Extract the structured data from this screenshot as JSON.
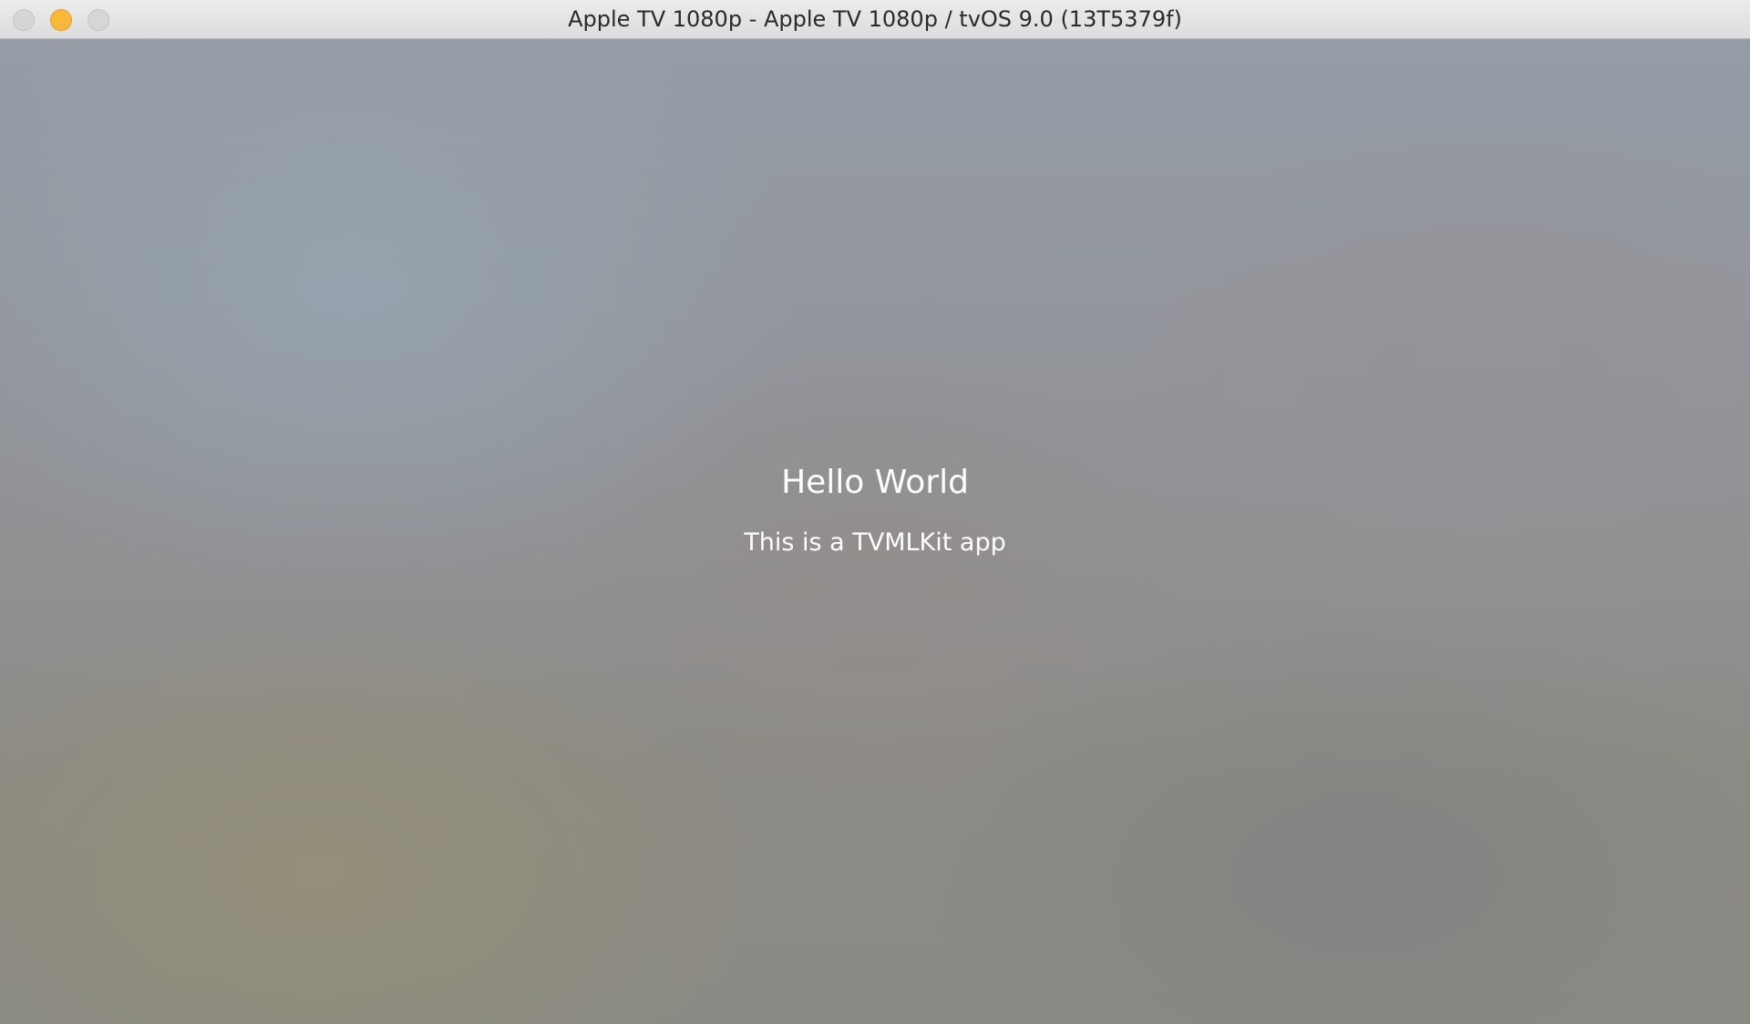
{
  "window": {
    "title": "Apple TV 1080p - Apple TV 1080p / tvOS 9.0 (13T5379f)",
    "controls": {
      "close_color": "#d6d6d6",
      "minimize_color": "#f8b93a",
      "zoom_color": "#d6d6d6"
    }
  },
  "app": {
    "heading": "Hello World",
    "subtitle": "This is a TVMLKit app"
  }
}
